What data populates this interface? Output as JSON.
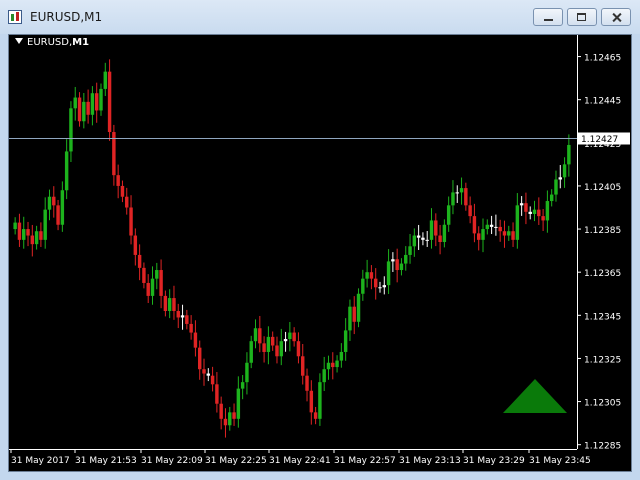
{
  "window": {
    "title": "EURUSD,M1",
    "icon": "chart-window-icon",
    "buttons": [
      "minimize-icon",
      "maximize-icon",
      "close-icon"
    ]
  },
  "chart_label": {
    "symbol": "EURUSD",
    "timeframe": "M1"
  },
  "colors": {
    "background": "#000000",
    "bull": "#1db31d",
    "bear": "#e02424",
    "doji": "#ffffff",
    "bid_line": "#8fa6bf",
    "axis": "#ffffff",
    "signal": "#0a7a0a"
  },
  "chart_data": {
    "type": "candlestick",
    "title": "",
    "xlabel": "",
    "ylabel": "",
    "ylim": [
      1.12283,
      1.12475
    ],
    "y_ticks": [
      "1.12465",
      "1.12445",
      "1.12425",
      "1.12405",
      "1.12385",
      "1.12365",
      "1.12345",
      "1.12325",
      "1.12305",
      "1.12285"
    ],
    "x_ticks": [
      "31 May 2017",
      "31 May 21:53",
      "31 May 22:09",
      "31 May 22:25",
      "31 May 22:41",
      "31 May 22:57",
      "31 May 23:13",
      "31 May 23:29",
      "31 May 23:45"
    ],
    "current_price": "1.12427",
    "grid": false,
    "close": [
      1.12388,
      1.1238,
      1.12385,
      1.12382,
      1.12378,
      1.12384,
      1.1238,
      1.12394,
      1.124,
      1.12396,
      1.12387,
      1.12403,
      1.12421,
      1.12441,
      1.12446,
      1.12435,
      1.12444,
      1.12438,
      1.12448,
      1.1244,
      1.1245,
      1.12458,
      1.1243,
      1.1241,
      1.12405,
      1.124,
      1.12395,
      1.12382,
      1.12373,
      1.12367,
      1.1236,
      1.12354,
      1.12362,
      1.12366,
      1.12354,
      1.12347,
      1.12353,
      1.12347,
      1.12344,
      1.12345,
      1.12341,
      1.12337,
      1.1233,
      1.1232,
      1.12318,
      1.12317,
      1.12313,
      1.12304,
      1.12297,
      1.12294,
      1.123,
      1.12297,
      1.12311,
      1.12314,
      1.12323,
      1.12333,
      1.12339,
      1.12332,
      1.12328,
      1.12335,
      1.12331,
      1.12326,
      1.12333,
      1.12334,
      1.12337,
      1.12333,
      1.12326,
      1.12317,
      1.1231,
      1.123,
      1.12297,
      1.12314,
      1.1232,
      1.12323,
      1.12321,
      1.12324,
      1.12328,
      1.12338,
      1.12349,
      1.12342,
      1.12355,
      1.12362,
      1.12365,
      1.12362,
      1.12358,
      1.12358,
      1.12359,
      1.1237,
      1.12371,
      1.12366,
      1.12369,
      1.12373,
      1.12377,
      1.12382,
      1.12381,
      1.1238,
      1.1238,
      1.12389,
      1.12382,
      1.12379,
      1.12387,
      1.12396,
      1.12402,
      1.12402,
      1.12404,
      1.12396,
      1.12391,
      1.12383,
      1.1238,
      1.12385,
      1.12387,
      1.12386,
      1.12386,
      1.12384,
      1.12382,
      1.12384,
      1.1238,
      1.12396,
      1.12397,
      1.12393,
      1.12392,
      1.12394,
      1.12391,
      1.12389,
      1.12398,
      1.12401,
      1.12408,
      1.12409,
      1.12415,
      1.12424
    ],
    "bid_line_value": 1.12427,
    "signal": "up-arrow"
  }
}
